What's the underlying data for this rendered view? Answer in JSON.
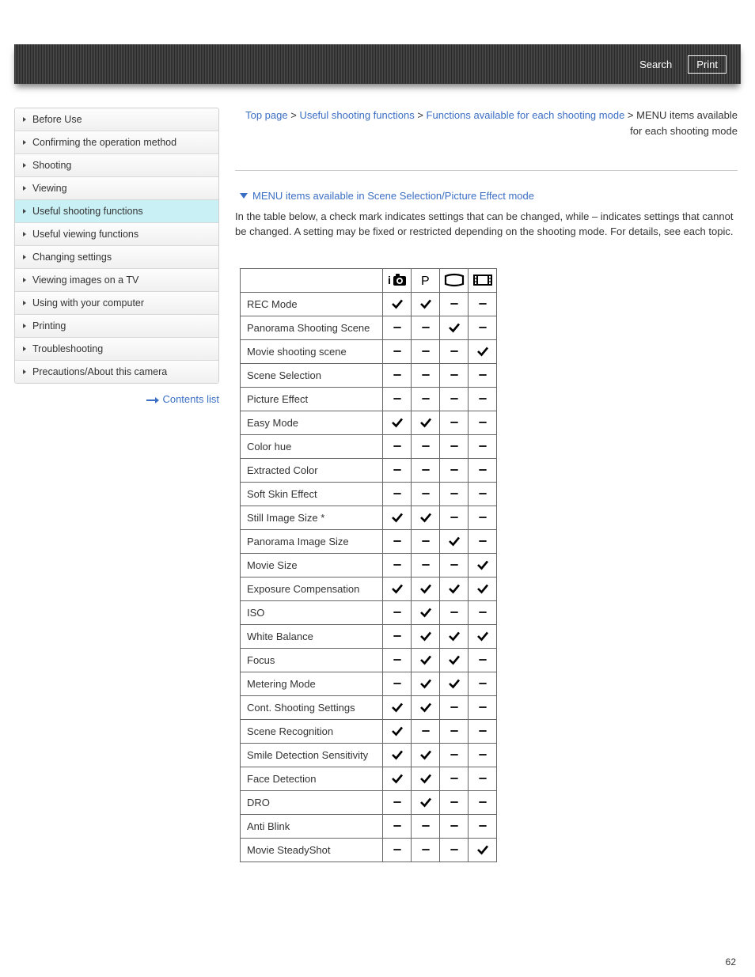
{
  "header": {
    "search_label": "Search",
    "print_label": "Print"
  },
  "sidebar": {
    "items": [
      {
        "label": "Before Use"
      },
      {
        "label": "Confirming the operation method"
      },
      {
        "label": "Shooting"
      },
      {
        "label": "Viewing"
      },
      {
        "label": "Useful shooting functions",
        "active": true
      },
      {
        "label": "Useful viewing functions"
      },
      {
        "label": "Changing settings"
      },
      {
        "label": "Viewing images on a TV"
      },
      {
        "label": "Using with your computer"
      },
      {
        "label": "Printing"
      },
      {
        "label": "Troubleshooting"
      },
      {
        "label": "Precautions/About this camera"
      }
    ],
    "contents_list_label": "Contents list"
  },
  "breadcrumb": {
    "parts": [
      "Top page",
      "Useful shooting functions",
      "Functions available for each shooting mode"
    ],
    "current": "MENU items available for each shooting mode",
    "sep": " > "
  },
  "section": {
    "link_label": "MENU items available in Scene Selection/Picture Effect mode",
    "intro": "In the table below, a check mark indicates settings that can be changed, while – indicates settings that cannot be changed. A setting may be fixed or restricted depending on the shooting mode. For details, see each topic."
  },
  "columns": [
    "intelligent-auto",
    "program-auto",
    "sweep-panorama",
    "movie"
  ],
  "rows": [
    {
      "label": "REC Mode",
      "vals": [
        "y",
        "y",
        "n",
        "n"
      ]
    },
    {
      "label": "Panorama Shooting Scene",
      "vals": [
        "n",
        "n",
        "y",
        "n"
      ]
    },
    {
      "label": "Movie shooting scene",
      "vals": [
        "n",
        "n",
        "n",
        "y"
      ]
    },
    {
      "label": "Scene Selection",
      "vals": [
        "n",
        "n",
        "n",
        "n"
      ]
    },
    {
      "label": "Picture Effect",
      "vals": [
        "n",
        "n",
        "n",
        "n"
      ]
    },
    {
      "label": "Easy Mode",
      "vals": [
        "y",
        "y",
        "n",
        "n"
      ]
    },
    {
      "label": "Color hue",
      "vals": [
        "n",
        "n",
        "n",
        "n"
      ]
    },
    {
      "label": "Extracted Color",
      "vals": [
        "n",
        "n",
        "n",
        "n"
      ]
    },
    {
      "label": "Soft Skin Effect",
      "vals": [
        "n",
        "n",
        "n",
        "n"
      ]
    },
    {
      "label": "Still Image Size *",
      "vals": [
        "y",
        "y",
        "n",
        "n"
      ]
    },
    {
      "label": "Panorama Image Size",
      "vals": [
        "n",
        "n",
        "y",
        "n"
      ]
    },
    {
      "label": "Movie Size",
      "vals": [
        "n",
        "n",
        "n",
        "y"
      ]
    },
    {
      "label": "Exposure Compensation",
      "vals": [
        "y",
        "y",
        "y",
        "y"
      ]
    },
    {
      "label": "ISO",
      "vals": [
        "n",
        "y",
        "n",
        "n"
      ]
    },
    {
      "label": "White Balance",
      "vals": [
        "n",
        "y",
        "y",
        "y"
      ]
    },
    {
      "label": "Focus",
      "vals": [
        "n",
        "y",
        "y",
        "n"
      ]
    },
    {
      "label": "Metering Mode",
      "vals": [
        "n",
        "y",
        "y",
        "n"
      ]
    },
    {
      "label": "Cont. Shooting Settings",
      "vals": [
        "y",
        "y",
        "n",
        "n"
      ]
    },
    {
      "label": "Scene Recognition",
      "vals": [
        "y",
        "n",
        "n",
        "n"
      ]
    },
    {
      "label": "Smile Detection Sensitivity",
      "vals": [
        "y",
        "y",
        "n",
        "n"
      ]
    },
    {
      "label": "Face Detection",
      "vals": [
        "y",
        "y",
        "n",
        "n"
      ]
    },
    {
      "label": "DRO",
      "vals": [
        "n",
        "y",
        "n",
        "n"
      ]
    },
    {
      "label": "Anti Blink",
      "vals": [
        "n",
        "n",
        "n",
        "n"
      ]
    },
    {
      "label": "Movie SteadyShot",
      "vals": [
        "n",
        "n",
        "n",
        "y"
      ]
    }
  ],
  "page_number": "62"
}
